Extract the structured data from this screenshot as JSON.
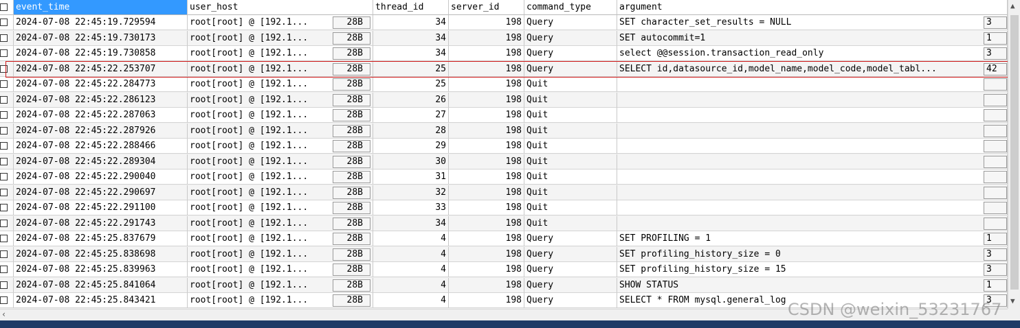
{
  "columns": [
    "event_time",
    "user_host",
    "thread_id",
    "server_id",
    "command_type",
    "argument"
  ],
  "rows": [
    {
      "event_time": "2024-07-08 22:45:19.729594",
      "user_host": "root[root] @  [192.1...",
      "blob": "28B",
      "thread_id": "34",
      "server_id": "198",
      "command_type": "Query",
      "argument": "SET character_set_results = NULL",
      "arg_size": "3"
    },
    {
      "event_time": "2024-07-08 22:45:19.730173",
      "user_host": "root[root] @  [192.1...",
      "blob": "28B",
      "thread_id": "34",
      "server_id": "198",
      "command_type": "Query",
      "argument": "SET autocommit=1",
      "arg_size": "1"
    },
    {
      "event_time": "2024-07-08 22:45:19.730858",
      "user_host": "root[root] @  [192.1...",
      "blob": "28B",
      "thread_id": "34",
      "server_id": "198",
      "command_type": "Query",
      "argument": "select @@session.transaction_read_only",
      "arg_size": "3"
    },
    {
      "event_time": "2024-07-08 22:45:22.253707",
      "user_host": "root[root] @  [192.1...",
      "blob": "28B",
      "thread_id": "25",
      "server_id": "198",
      "command_type": "Query",
      "argument": "SELECT  id,datasource_id,model_name,model_code,model_tabl...",
      "arg_size": "42"
    },
    {
      "event_time": "2024-07-08 22:45:22.284773",
      "user_host": "root[root] @  [192.1...",
      "blob": "28B",
      "thread_id": "25",
      "server_id": "198",
      "command_type": "Quit",
      "argument": "",
      "arg_size": ""
    },
    {
      "event_time": "2024-07-08 22:45:22.286123",
      "user_host": "root[root] @  [192.1...",
      "blob": "28B",
      "thread_id": "26",
      "server_id": "198",
      "command_type": "Quit",
      "argument": "",
      "arg_size": ""
    },
    {
      "event_time": "2024-07-08 22:45:22.287063",
      "user_host": "root[root] @  [192.1...",
      "blob": "28B",
      "thread_id": "27",
      "server_id": "198",
      "command_type": "Quit",
      "argument": "",
      "arg_size": ""
    },
    {
      "event_time": "2024-07-08 22:45:22.287926",
      "user_host": "root[root] @  [192.1...",
      "blob": "28B",
      "thread_id": "28",
      "server_id": "198",
      "command_type": "Quit",
      "argument": "",
      "arg_size": ""
    },
    {
      "event_time": "2024-07-08 22:45:22.288466",
      "user_host": "root[root] @  [192.1...",
      "blob": "28B",
      "thread_id": "29",
      "server_id": "198",
      "command_type": "Quit",
      "argument": "",
      "arg_size": ""
    },
    {
      "event_time": "2024-07-08 22:45:22.289304",
      "user_host": "root[root] @  [192.1...",
      "blob": "28B",
      "thread_id": "30",
      "server_id": "198",
      "command_type": "Quit",
      "argument": "",
      "arg_size": ""
    },
    {
      "event_time": "2024-07-08 22:45:22.290040",
      "user_host": "root[root] @  [192.1...",
      "blob": "28B",
      "thread_id": "31",
      "server_id": "198",
      "command_type": "Quit",
      "argument": "",
      "arg_size": ""
    },
    {
      "event_time": "2024-07-08 22:45:22.290697",
      "user_host": "root[root] @  [192.1...",
      "blob": "28B",
      "thread_id": "32",
      "server_id": "198",
      "command_type": "Quit",
      "argument": "",
      "arg_size": ""
    },
    {
      "event_time": "2024-07-08 22:45:22.291100",
      "user_host": "root[root] @  [192.1...",
      "blob": "28B",
      "thread_id": "33",
      "server_id": "198",
      "command_type": "Quit",
      "argument": "",
      "arg_size": ""
    },
    {
      "event_time": "2024-07-08 22:45:22.291743",
      "user_host": "root[root] @  [192.1...",
      "blob": "28B",
      "thread_id": "34",
      "server_id": "198",
      "command_type": "Quit",
      "argument": "",
      "arg_size": ""
    },
    {
      "event_time": "2024-07-08 22:45:25.837679",
      "user_host": "root[root] @  [192.1...",
      "blob": "28B",
      "thread_id": "4",
      "server_id": "198",
      "command_type": "Query",
      "argument": "SET PROFILING = 1",
      "arg_size": "1"
    },
    {
      "event_time": "2024-07-08 22:45:25.838698",
      "user_host": "root[root] @  [192.1...",
      "blob": "28B",
      "thread_id": "4",
      "server_id": "198",
      "command_type": "Query",
      "argument": "SET profiling_history_size = 0",
      "arg_size": "3"
    },
    {
      "event_time": "2024-07-08 22:45:25.839963",
      "user_host": "root[root] @  [192.1...",
      "blob": "28B",
      "thread_id": "4",
      "server_id": "198",
      "command_type": "Query",
      "argument": "SET profiling_history_size = 15",
      "arg_size": "3"
    },
    {
      "event_time": "2024-07-08 22:45:25.841064",
      "user_host": "root[root] @  [192.1...",
      "blob": "28B",
      "thread_id": "4",
      "server_id": "198",
      "command_type": "Query",
      "argument": "SHOW STATUS",
      "arg_size": "1"
    },
    {
      "event_time": "2024-07-08 22:45:25.843421",
      "user_host": "root[root] @  [192.1...",
      "blob": "28B",
      "thread_id": "4",
      "server_id": "198",
      "command_type": "Query",
      "argument": "SELECT * FROM mysql.general_log",
      "arg_size": "3"
    }
  ],
  "watermark": "CSDN @weixin_53231767",
  "icons": {
    "scroll_up": "chevron-up-icon",
    "scroll_down": "chevron-down-icon",
    "scroll_left": "chevron-left-icon"
  },
  "colors": {
    "header_selected": "#3399ff",
    "highlight_border": "#d01818",
    "status_bar": "#1f3a66"
  }
}
